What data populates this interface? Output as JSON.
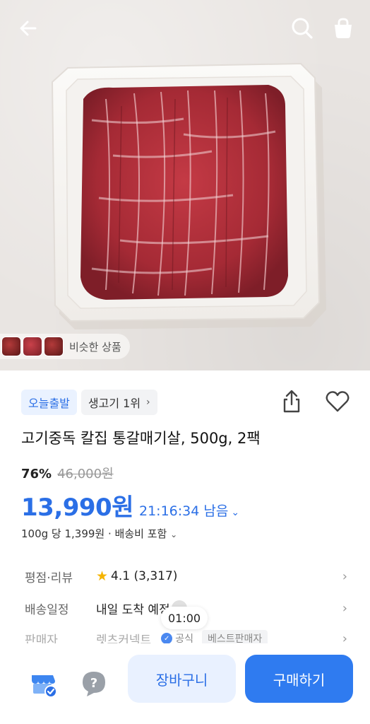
{
  "colors": {
    "accent": "#2b6fe6",
    "buy_button": "#2f7bf0",
    "cart_button_bg": "#e9f1ff",
    "star": "#f5b400"
  },
  "hero": {
    "similar_label": "비슷한 상품"
  },
  "badges": {
    "today_ship": "오늘출발",
    "rank": "생고기 1위"
  },
  "product": {
    "title": "고기중독 칼집 통갈매기살, 500g, 2팩",
    "discount_pct": "76%",
    "original_price": "46,000원",
    "price": "13,990원",
    "timer": "21:16:34 남음",
    "unit_price": "100g 당 1,399원 · 배송비 포함"
  },
  "info": {
    "rating_label": "평점·리뷰",
    "rating_value": "4.1",
    "rating_count": "(3,317)",
    "delivery_label": "배송일정",
    "delivery_value": "내일 도착 예정",
    "seller_label": "판매자",
    "seller_value": "렛츠커넥트",
    "official_label": "공식",
    "best_seller_label": "베스트판매자"
  },
  "video_time": "01:00",
  "bottom": {
    "cart_label": "장바구니",
    "buy_label": "구매하기"
  },
  "icons": [
    "back-arrow-icon",
    "search-icon",
    "shopping-bag-icon",
    "share-icon",
    "heart-icon",
    "chevron-right-icon",
    "star-icon",
    "store-icon",
    "help-icon"
  ]
}
